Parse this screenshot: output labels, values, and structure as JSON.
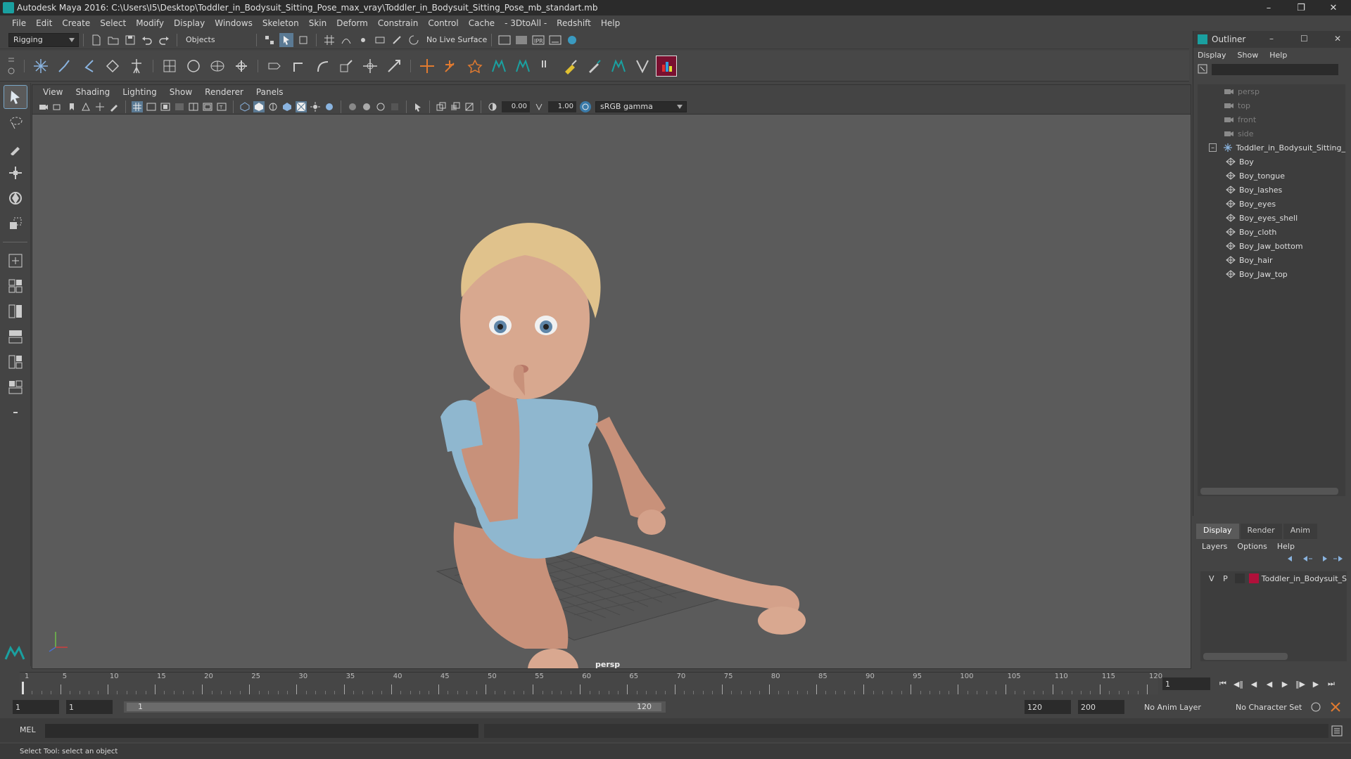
{
  "window": {
    "title": "Autodesk Maya 2016: C:\\Users\\I5\\Desktop\\Toddler_in_Bodysuit_Sitting_Pose_max_vray\\Toddler_in_Bodysuit_Sitting_Pose_mb_standart.mb"
  },
  "menubar": {
    "items": [
      "File",
      "Edit",
      "Create",
      "Select",
      "Modify",
      "Display",
      "Windows",
      "Skeleton",
      "Skin",
      "Deform",
      "Constrain",
      "Control",
      "Cache",
      "- 3DtoAll -",
      "Redshift",
      "Help"
    ]
  },
  "statusline": {
    "menuset": "Rigging",
    "selection_mode": "Objects",
    "live_surface": "No Live Surface"
  },
  "panel": {
    "menu": [
      "View",
      "Shading",
      "Lighting",
      "Show",
      "Renderer",
      "Panels"
    ],
    "exposure": "0.00",
    "gamma": "1.00",
    "color_space": "sRGB gamma",
    "camera_label": "persp"
  },
  "outliner": {
    "title": "Outliner",
    "menu": [
      "Display",
      "Show",
      "Help"
    ],
    "cameras": [
      "persp",
      "top",
      "front",
      "side"
    ],
    "root": "Toddler_in_Bodysuit_Sitting_",
    "children": [
      "Boy",
      "Boy_tongue",
      "Boy_lashes",
      "Boy_eyes",
      "Boy_eyes_shell",
      "Boy_cloth",
      "Boy_Jaw_bottom",
      "Boy_hair",
      "Boy_Jaw_top"
    ]
  },
  "layer_editor": {
    "tabs": [
      "Display",
      "Render",
      "Anim"
    ],
    "menu": [
      "Layers",
      "Options",
      "Help"
    ],
    "layer": {
      "v": "V",
      "p": "P",
      "name": "Toddler_in_Bodysuit_S",
      "color": "#b0103a"
    }
  },
  "timeline": {
    "ticks": [
      "1",
      "5",
      "10",
      "15",
      "20",
      "25",
      "30",
      "35",
      "40",
      "45",
      "50",
      "55",
      "60",
      "65",
      "70",
      "75",
      "80",
      "85",
      "90",
      "95",
      "100",
      "105",
      "110",
      "115",
      "120"
    ],
    "current_frame": "1"
  },
  "range": {
    "start": "1",
    "playback_start": "1",
    "range_start_label": "1",
    "range_end_label": "120",
    "playback_end": "120",
    "end": "200",
    "anim_layer": "No Anim Layer",
    "character_set": "No Character Set"
  },
  "commandline": {
    "label": "MEL"
  },
  "helpline": {
    "text": "Select Tool: select an object"
  },
  "colors": {
    "accent": "#1aa0a0",
    "layer_color": "#b0103a",
    "viewport_bg": "#5b5b5b"
  }
}
